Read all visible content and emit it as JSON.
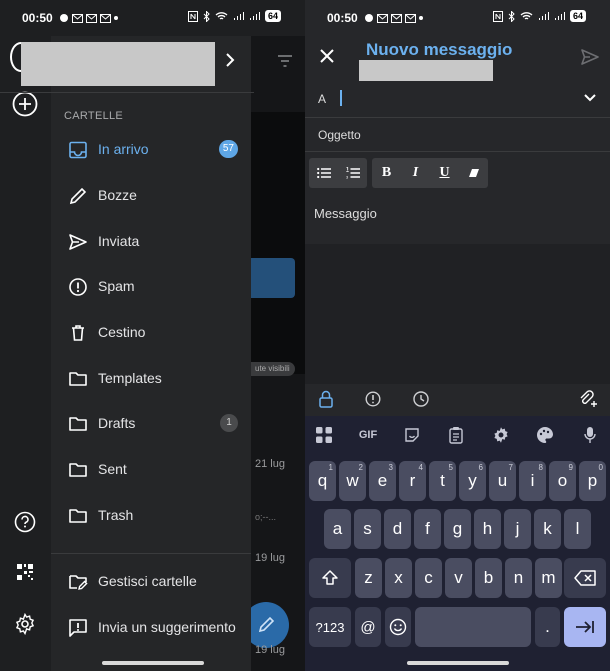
{
  "left_screen": {
    "status_time": "00:50",
    "battery": "64",
    "drawer": {
      "section_label": "CARTELLE",
      "folders": [
        {
          "label": "In arrivo",
          "icon": "inbox-icon",
          "badge": "57",
          "active": true
        },
        {
          "label": "Bozze",
          "icon": "pencil-icon",
          "badge": ""
        },
        {
          "label": "Inviata",
          "icon": "send-icon",
          "badge": ""
        },
        {
          "label": "Spam",
          "icon": "alert-circle-icon",
          "badge": ""
        },
        {
          "label": "Cestino",
          "icon": "trash-icon",
          "badge": ""
        },
        {
          "label": "Templates",
          "icon": "folder-icon",
          "badge": ""
        },
        {
          "label": "Drafts",
          "icon": "folder-icon",
          "badge": "1"
        },
        {
          "label": "Sent",
          "icon": "folder-icon",
          "badge": ""
        },
        {
          "label": "Trash",
          "icon": "folder-icon",
          "badge": ""
        }
      ],
      "footer": [
        {
          "label": "Gestisci cartelle",
          "icon": "manage-folders-icon"
        },
        {
          "label": "Invia un suggerimento",
          "icon": "feedback-icon"
        }
      ]
    },
    "background_list": {
      "chip_text": "ute visibili",
      "dates": [
        "21 lug",
        "19 lug",
        "19 lug"
      ],
      "snippet": "o;--..."
    },
    "accent_color": "#6cb1ef"
  },
  "right_screen": {
    "status_time": "00:50",
    "battery": "64",
    "compose": {
      "title": "Nuovo messaggio",
      "to_label": "A",
      "subject_placeholder": "Oggetto",
      "body_placeholder": "Messaggio"
    },
    "format_toolbar": {
      "bold": "B",
      "italic": "I",
      "underline": "U"
    },
    "keyboard": {
      "toolbar_gif": "GIF",
      "row1": [
        {
          "k": "q",
          "s": "1"
        },
        {
          "k": "w",
          "s": "2"
        },
        {
          "k": "e",
          "s": "3"
        },
        {
          "k": "r",
          "s": "4"
        },
        {
          "k": "t",
          "s": "5"
        },
        {
          "k": "y",
          "s": "6"
        },
        {
          "k": "u",
          "s": "7"
        },
        {
          "k": "i",
          "s": "8"
        },
        {
          "k": "o",
          "s": "9"
        },
        {
          "k": "p",
          "s": "0"
        }
      ],
      "row2": [
        "a",
        "s",
        "d",
        "f",
        "g",
        "h",
        "j",
        "k",
        "l"
      ],
      "row3": [
        "z",
        "x",
        "c",
        "v",
        "b",
        "n",
        "m"
      ],
      "numbers_key": "?123",
      "at_key": "@",
      "period_key": "."
    }
  }
}
